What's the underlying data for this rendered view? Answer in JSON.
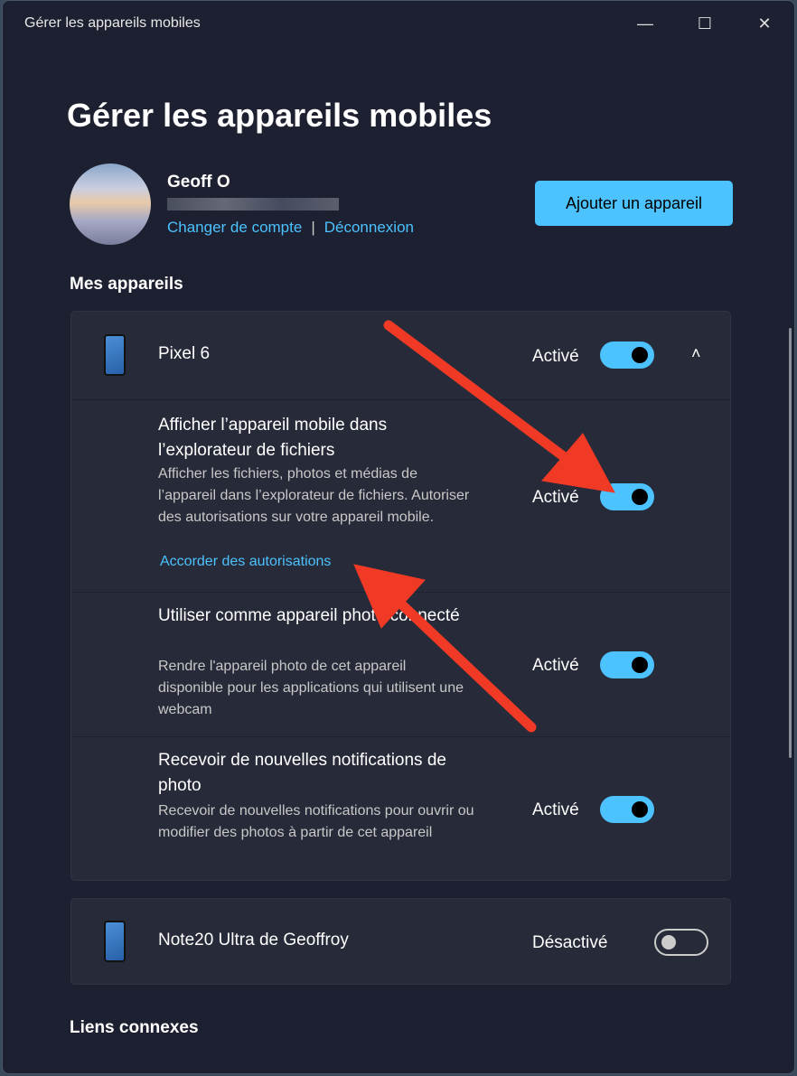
{
  "window": {
    "title": "Gérer les appareils mobiles",
    "minimize": "—",
    "maximize": "☐",
    "close": "✕"
  },
  "page_title": "Gérer les appareils mobiles",
  "account": {
    "name": "Geoff O",
    "change_account": "Changer de compte",
    "separator": "|",
    "logout": "Déconnexion"
  },
  "add_device": "Ajouter un appareil",
  "my_devices": "Mes appareils",
  "devices": [
    {
      "name": "Pixel 6",
      "state": "Activé",
      "enabled": true,
      "expanded": true,
      "settings": [
        {
          "title": "Afficher l’appareil mobile dans l’explorateur de fichiers",
          "desc": "Afficher les fichiers, photos et médias de l’appareil dans l’explorateur de fichiers. Autoriser des autorisations sur votre appareil mobile.",
          "link": "Accorder des autorisations",
          "state": "Activé",
          "enabled": true
        },
        {
          "title": "Utiliser comme appareil photo connecté",
          "desc": "Rendre l'appareil photo de cet appareil disponible pour les applications qui utilisent une webcam",
          "state": "Activé",
          "enabled": true
        },
        {
          "title": "Recevoir de nouvelles notifications de photo",
          "desc": "Recevoir de nouvelles notifications pour ouvrir ou modifier des photos à partir de cet appareil",
          "state": "Activé",
          "enabled": true
        }
      ]
    },
    {
      "name": "Note20 Ultra de Geoffroy",
      "state": "Désactivé",
      "enabled": false
    }
  ],
  "related_links": "Liens connexes",
  "colors": {
    "accent": "#4cc2ff",
    "annotation_arrow": "#f03a26"
  }
}
